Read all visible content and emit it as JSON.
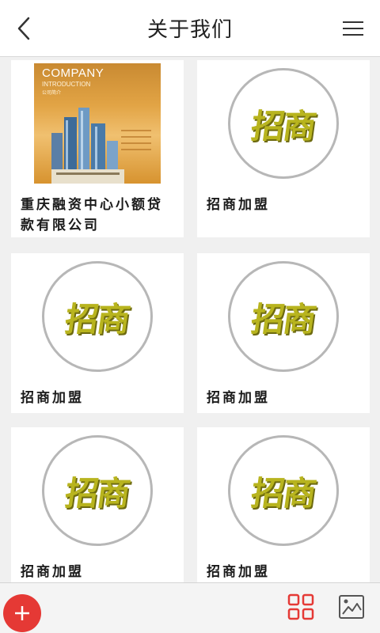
{
  "header": {
    "title": "关于我们",
    "back_icon": "chevron-left-icon",
    "menu_icon": "hamburger-menu-icon"
  },
  "cover": {
    "line1": "COMPANY",
    "line2": "INTRODUCTION",
    "line3": "公司简介"
  },
  "badge_text": "招商",
  "items": [
    {
      "label": "重庆融资中心小额贷款有限公司",
      "type": "cover"
    },
    {
      "label": "招商加盟",
      "type": "badge"
    },
    {
      "label": "招商加盟",
      "type": "badge"
    },
    {
      "label": "招商加盟",
      "type": "badge"
    },
    {
      "label": "招商加盟",
      "type": "badge"
    },
    {
      "label": "招商加盟",
      "type": "badge"
    }
  ],
  "bottom": {
    "add_icon": "plus-icon",
    "grid_icon": "grid-view-icon",
    "image_icon": "image-gallery-icon"
  },
  "colors": {
    "accent": "#e53935",
    "badge_text": "#b8b41e",
    "badge_ring": "#b7b7b7"
  }
}
